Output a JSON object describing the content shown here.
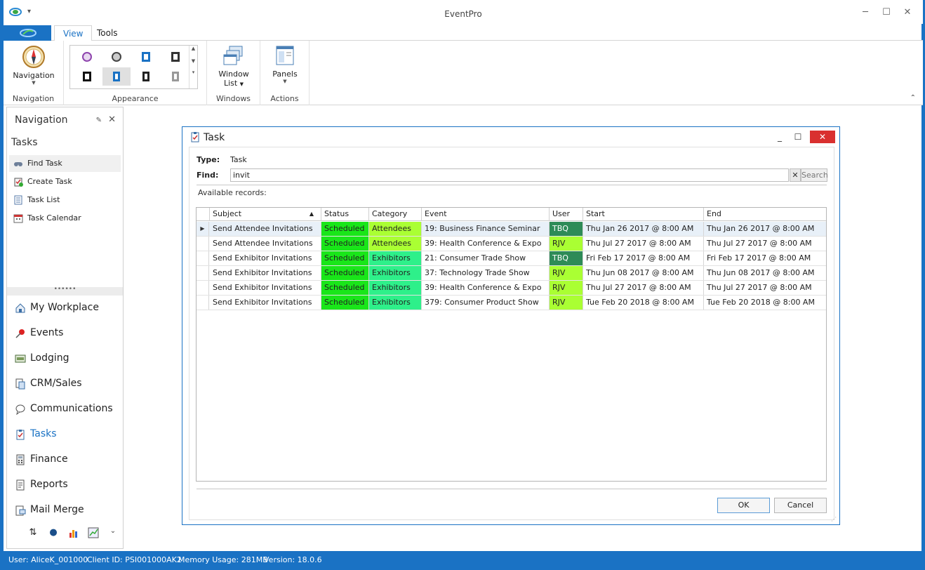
{
  "window": {
    "title": "EventPro",
    "minimize": "─",
    "maximize": "☐",
    "close": "✕"
  },
  "ribbon": {
    "tabs": [
      {
        "label": "View"
      },
      {
        "label": "Tools"
      }
    ],
    "navigation_button": "Navigation",
    "window_list_button": [
      "Window",
      "List"
    ],
    "panels_button": "Panels",
    "groups": {
      "navigation": "Navigation",
      "appearance": "Appearance",
      "windows": "Windows",
      "actions": "Actions"
    }
  },
  "nav": {
    "title": "Navigation",
    "section": "Tasks",
    "items": [
      {
        "label": "Find Task",
        "icon": "binoculars-icon"
      },
      {
        "label": "Create Task",
        "icon": "task-add-icon"
      },
      {
        "label": "Task List",
        "icon": "task-list-icon"
      },
      {
        "label": "Task Calendar",
        "icon": "calendar-icon"
      }
    ],
    "splitter": "••••••",
    "modules": [
      {
        "label": "My Workplace",
        "icon": "house-icon"
      },
      {
        "label": "Events",
        "icon": "pushpin-icon"
      },
      {
        "label": "Lodging",
        "icon": "lodging-icon"
      },
      {
        "label": "CRM/Sales",
        "icon": "crm-icon"
      },
      {
        "label": "Communications",
        "icon": "speech-bubble-icon"
      },
      {
        "label": "Tasks",
        "icon": "clipboard-icon"
      },
      {
        "label": "Finance",
        "icon": "calculator-icon"
      },
      {
        "label": "Reports",
        "icon": "report-icon"
      },
      {
        "label": "Mail Merge",
        "icon": "mail-merge-icon"
      }
    ]
  },
  "dialog": {
    "title": "Task",
    "type_label": "Type:",
    "type_value": "Task",
    "find_label": "Find:",
    "find_value": "invit",
    "search_button": "Search",
    "available_label": "Available records:",
    "columns": [
      "Subject",
      "Status",
      "Category",
      "Event",
      "User",
      "Start",
      "End"
    ],
    "rows": [
      {
        "subject": "Send Attendee Invitations",
        "status": "Scheduled",
        "category": "Attendees",
        "event": "19: Business Finance Seminar",
        "user": "TBQ",
        "start": "Thu Jan 26 2017 @ 8:00 AM",
        "end": "Thu Jan 26 2017 @ 8:00 AM"
      },
      {
        "subject": "Send Attendee Invitations",
        "status": "Scheduled",
        "category": "Attendees",
        "event": "39: Health Conference & Expo",
        "user": "RJV",
        "start": "Thu Jul 27 2017 @ 8:00 AM",
        "end": "Thu Jul 27 2017 @ 8:00 AM"
      },
      {
        "subject": "Send Exhibitor Invitations",
        "status": "Scheduled",
        "category": "Exhibitors",
        "event": "21: Consumer Trade Show",
        "user": "TBQ",
        "start": "Fri Feb 17 2017 @ 8:00 AM",
        "end": "Fri Feb 17 2017 @ 8:00 AM"
      },
      {
        "subject": "Send Exhibitor Invitations",
        "status": "Scheduled",
        "category": "Exhibitors",
        "event": "37: Technology Trade Show",
        "user": "RJV",
        "start": "Thu Jun 08 2017 @ 8:00 AM",
        "end": "Thu Jun 08 2017 @ 8:00 AM"
      },
      {
        "subject": "Send Exhibitor Invitations",
        "status": "Scheduled",
        "category": "Exhibitors",
        "event": "39: Health Conference & Expo",
        "user": "RJV",
        "start": "Thu Jul 27 2017 @ 8:00 AM",
        "end": "Thu Jul 27 2017 @ 8:00 AM"
      },
      {
        "subject": "Send Exhibitor Invitations",
        "status": "Scheduled",
        "category": "Exhibitors",
        "event": "379: Consumer Product Show",
        "user": "RJV",
        "start": "Tue Feb 20 2018 @ 8:00 AM",
        "end": "Tue Feb 20 2018 @ 8:00 AM"
      }
    ],
    "ok_button": "OK",
    "cancel_button": "Cancel"
  },
  "colors": {
    "accent": "#1a72c4",
    "status_scheduled": "#19e619",
    "category_attendees": "#aaff33",
    "category_exhibitors": "#2ef08a",
    "user_tbq": "#2e8b57",
    "user_rjv": "#aaff33"
  },
  "statusbar": {
    "user": "User: AliceK_001000",
    "client": "Client ID: PSI001000AK2",
    "memory": "Memory Usage: 281MB",
    "version": "Version: 18.0.6"
  }
}
